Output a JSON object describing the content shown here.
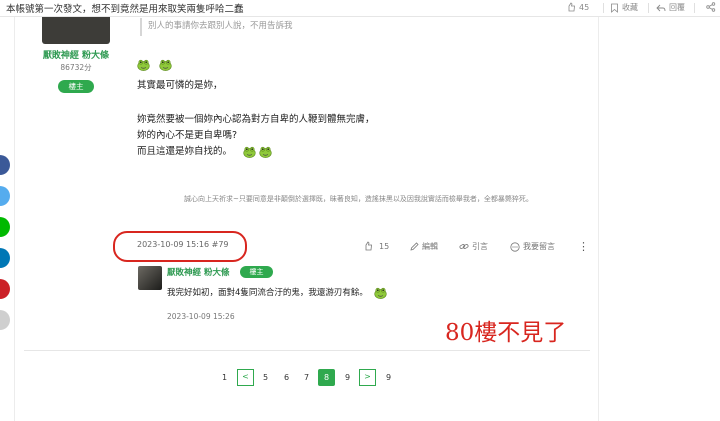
{
  "header": {
    "title": "本帳號第一次發文，想不到竟然是用來取笑兩隻呼哈二蠢",
    "like_count": "45",
    "collect_label": "收藏",
    "reply_label": "回覆"
  },
  "colors": {
    "brand_green": "#2fa94e",
    "annotation_red": "#d8261f"
  },
  "share_rail": {
    "icons": [
      "facebook-icon",
      "twitter-icon",
      "line-icon",
      "linkedin-icon",
      "pinterest-icon",
      "copy-link-icon"
    ]
  },
  "author": {
    "name": "厭敗神經 粉大條",
    "points": "86732分",
    "badge": "樓主"
  },
  "post": {
    "quote": "別人的事請你去跟別人說，不用告訴我",
    "lines": [
      "其實最可憐的是妳，",
      "妳竟然要被一個妳內心認為對方自卑的人鞭到體無完膚，",
      "妳的內心不是更自卑嗎?",
      "而且這還是妳自找的。"
    ],
    "signature": "誠心向上天祈求~只要同意是非顛倒於選擇既，昧著良知，造謠抹黑以及因我說實話而檢舉我者，全都暴斃猝死。",
    "datetime": "2023-10-09 15:16 #79",
    "gp_count": "15",
    "edit_label": "編輯",
    "quote_label": "引言",
    "comment_label": "我要留言"
  },
  "reply": {
    "name": "厭敗神經 粉大條",
    "badge": "樓主",
    "text": "我完好如初，面對4隻同流合汙的鬼，我還游刃有餘。",
    "datetime": "2023-10-09 15:26"
  },
  "annotation": "80樓不見了",
  "pagination": {
    "pages": [
      "1",
      "5",
      "6",
      "7",
      "8",
      "9",
      "9"
    ],
    "current": "8"
  }
}
